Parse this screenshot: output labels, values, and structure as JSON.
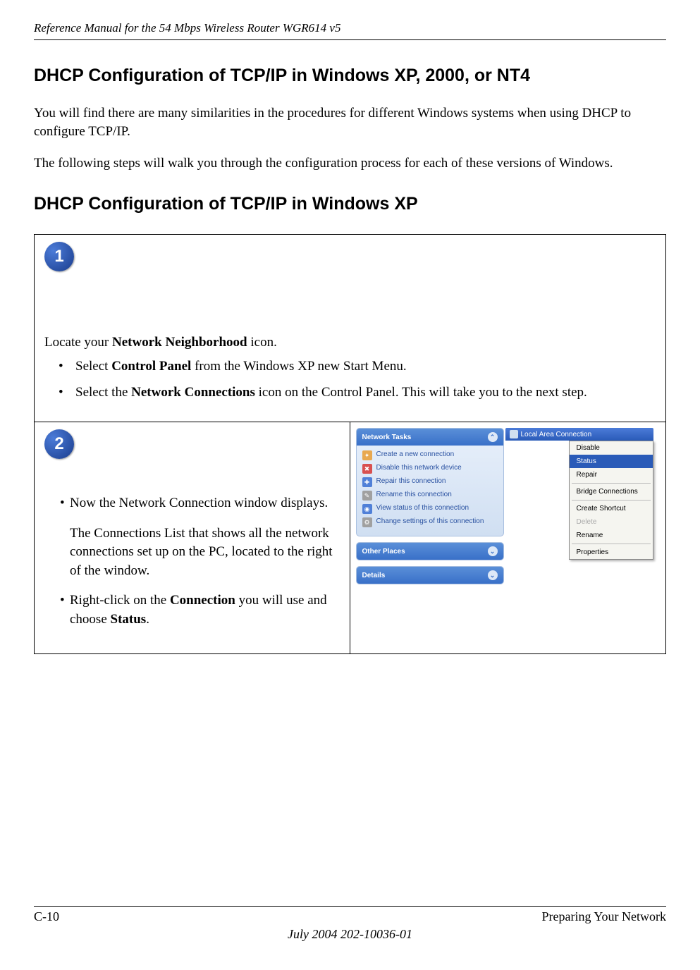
{
  "header": {
    "manual_title": "Reference Manual for the 54 Mbps Wireless Router WGR614 v5"
  },
  "section": {
    "heading": "DHCP Configuration of TCP/IP in Windows XP, 2000, or NT4",
    "para1": "You will find there are many similarities in the procedures for different Windows systems when using DHCP to configure TCP/IP.",
    "para2": "The following steps will walk you through the configuration process for each of these versions of Windows.",
    "subheading": "DHCP Configuration of TCP/IP in Windows XP"
  },
  "step1": {
    "number": "1",
    "locate_pre": "Locate your ",
    "locate_bold": "Network Neighborhood",
    "locate_post": " icon.",
    "bullet1_pre": "Select ",
    "bullet1_bold": "Control Panel",
    "bullet1_post": " from the Windows XP new Start Menu.",
    "bullet2_pre": "Select the ",
    "bullet2_bold": "Network Connections",
    "bullet2_post": " icon on the Control Panel.  This will take you to the next step."
  },
  "step2": {
    "number": "2",
    "bullet1": "Now the Network Connection window displays.",
    "para": "The Connections List that shows all the network connections set up on the PC, located to the right of the window.",
    "bullet2_pre": "Right-click on the ",
    "bullet2_bold1": "Connection",
    "bullet2_mid": " you will use and choose ",
    "bullet2_bold2": "Status",
    "bullet2_post": "."
  },
  "xp_panel": {
    "network_tasks_title": "Network Tasks",
    "tasks": {
      "t1": "Create a new connection",
      "t2": "Disable this network device",
      "t3": "Repair this connection",
      "t4": "Rename this connection",
      "t5": "View status of this connection",
      "t6": "Change settings of this connection"
    },
    "other_places_title": "Other Places",
    "details_title": "Details",
    "lac_label": "Local Area Connection"
  },
  "context_menu": {
    "disable": "Disable",
    "status": "Status",
    "repair": "Repair",
    "bridge": "Bridge Connections",
    "shortcut": "Create Shortcut",
    "delete": "Delete",
    "rename": "Rename",
    "properties": "Properties"
  },
  "footer": {
    "page_num": "C-10",
    "section_name": "Preparing Your Network",
    "date_doc": "July 2004 202-10036-01"
  }
}
